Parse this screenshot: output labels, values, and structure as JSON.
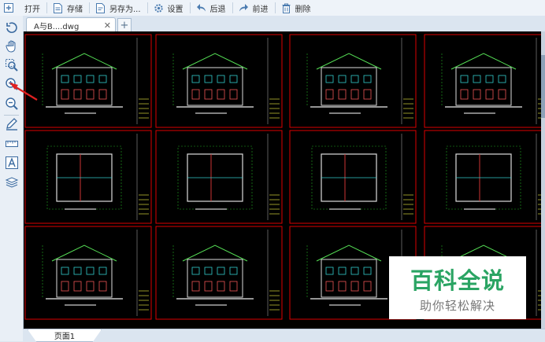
{
  "toolbar": {
    "open": "打开",
    "save": "存储",
    "save_as": "另存为...",
    "settings": "设置",
    "back": "后退",
    "forward": "前进",
    "delete": "删除"
  },
  "tabs": {
    "doc_title": "A与B....dwg",
    "close_glyph": "✕",
    "add_glyph": "+"
  },
  "side_tools": [
    "rotate-icon",
    "pan-hand-icon",
    "zoom-window-icon",
    "zoom-in-icon",
    "zoom-out-icon",
    "pen-icon",
    "measure-icon",
    "text-icon",
    "layers-icon"
  ],
  "page_tab": "页面1",
  "watermark": {
    "title": "百科全说",
    "subtitle": "助你轻松解决"
  },
  "colors": {
    "canvas": "#000000",
    "sheet_border": "#dd0000",
    "watermark_green": "#2aa463",
    "arrow_red": "#e02020"
  }
}
